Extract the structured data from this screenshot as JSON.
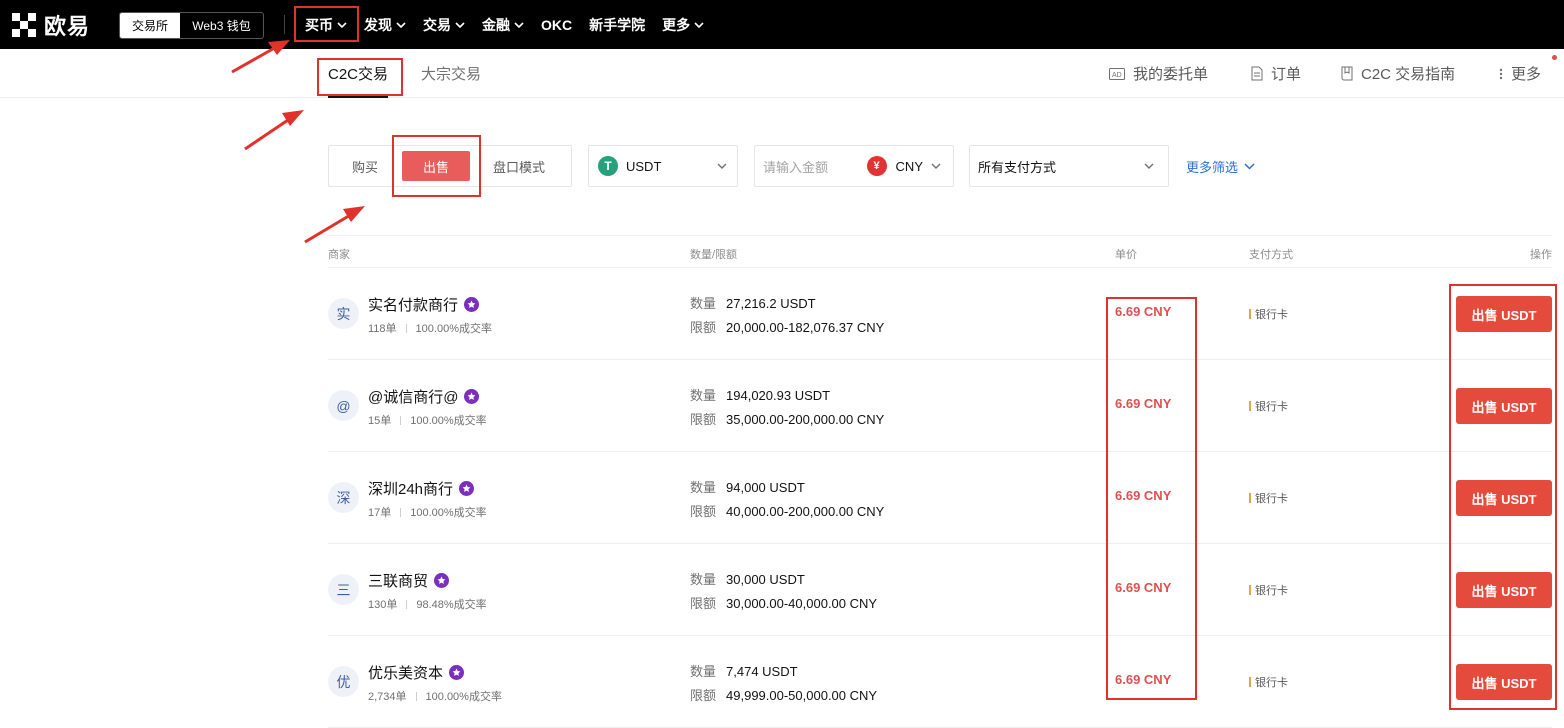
{
  "brand": {
    "name": "欧易"
  },
  "top_switch": {
    "exchange": "交易所",
    "wallet": "Web3 钱包"
  },
  "nav": [
    {
      "label": "买币",
      "has_dropdown": true
    },
    {
      "label": "发现",
      "has_dropdown": true
    },
    {
      "label": "交易",
      "has_dropdown": true
    },
    {
      "label": "金融",
      "has_dropdown": true
    },
    {
      "label": "OKC",
      "has_dropdown": false
    },
    {
      "label": "新手学院",
      "has_dropdown": false
    },
    {
      "label": "更多",
      "has_dropdown": true
    }
  ],
  "subnav": {
    "tabs": [
      {
        "label": "C2C交易",
        "active": true
      },
      {
        "label": "大宗交易",
        "active": false
      }
    ],
    "links": [
      {
        "label": "我的委托单",
        "icon": "ad-icon"
      },
      {
        "label": "订单",
        "icon": "document-icon"
      },
      {
        "label": "C2C 交易指南",
        "icon": "book-icon"
      },
      {
        "label": "更多",
        "icon": "more-vertical-icon"
      }
    ]
  },
  "filters": {
    "buy": "购买",
    "sell": "出售",
    "orderbook": "盘口模式",
    "coin": "USDT",
    "coin_symbol": "T",
    "amount_placeholder": "请输入金额",
    "currency": "CNY",
    "currency_symbol": "¥",
    "payment": "所有支付方式",
    "more_filters": "更多筛选"
  },
  "table": {
    "headers": {
      "merchant": "商家",
      "quantity": "数量/限额",
      "price": "单价",
      "payment": "支付方式",
      "action": "操作"
    },
    "qty_label": "数量",
    "limit_label": "限额",
    "rows": [
      {
        "avatar": "实",
        "name": "实名付款商行",
        "orders": "118单",
        "rate": "100.00%成交率",
        "quantity": "27,216.2 USDT",
        "limit": "20,000.00-182,076.37 CNY",
        "price": "6.69 CNY",
        "payment": "银行卡",
        "action": "出售 USDT"
      },
      {
        "avatar": "@",
        "name": "@诚信商行@",
        "orders": "15单",
        "rate": "100.00%成交率",
        "quantity": "194,020.93 USDT",
        "limit": "35,000.00-200,000.00 CNY",
        "price": "6.69 CNY",
        "payment": "银行卡",
        "action": "出售 USDT"
      },
      {
        "avatar": "深",
        "name": "深圳24h商行",
        "orders": "17单",
        "rate": "100.00%成交率",
        "quantity": "94,000 USDT",
        "limit": "40,000.00-200,000.00 CNY",
        "price": "6.69 CNY",
        "payment": "银行卡",
        "action": "出售 USDT"
      },
      {
        "avatar": "三",
        "name": "三联商贸",
        "orders": "130单",
        "rate": "98.48%成交率",
        "quantity": "30,000 USDT",
        "limit": "30,000.00-40,000.00 CNY",
        "price": "6.69 CNY",
        "payment": "银行卡",
        "action": "出售 USDT"
      },
      {
        "avatar": "优",
        "name": "优乐美资本",
        "orders": "2,734单",
        "rate": "100.00%成交率",
        "quantity": "7,474 USDT",
        "limit": "49,999.00-50,000.00 CNY",
        "price": "6.69 CNY",
        "payment": "银行卡",
        "action": "出售 USDT"
      }
    ]
  },
  "colors": {
    "accent_red": "#e54b3c",
    "link_blue": "#2f6fcb",
    "annotation_red": "#e0322b"
  }
}
